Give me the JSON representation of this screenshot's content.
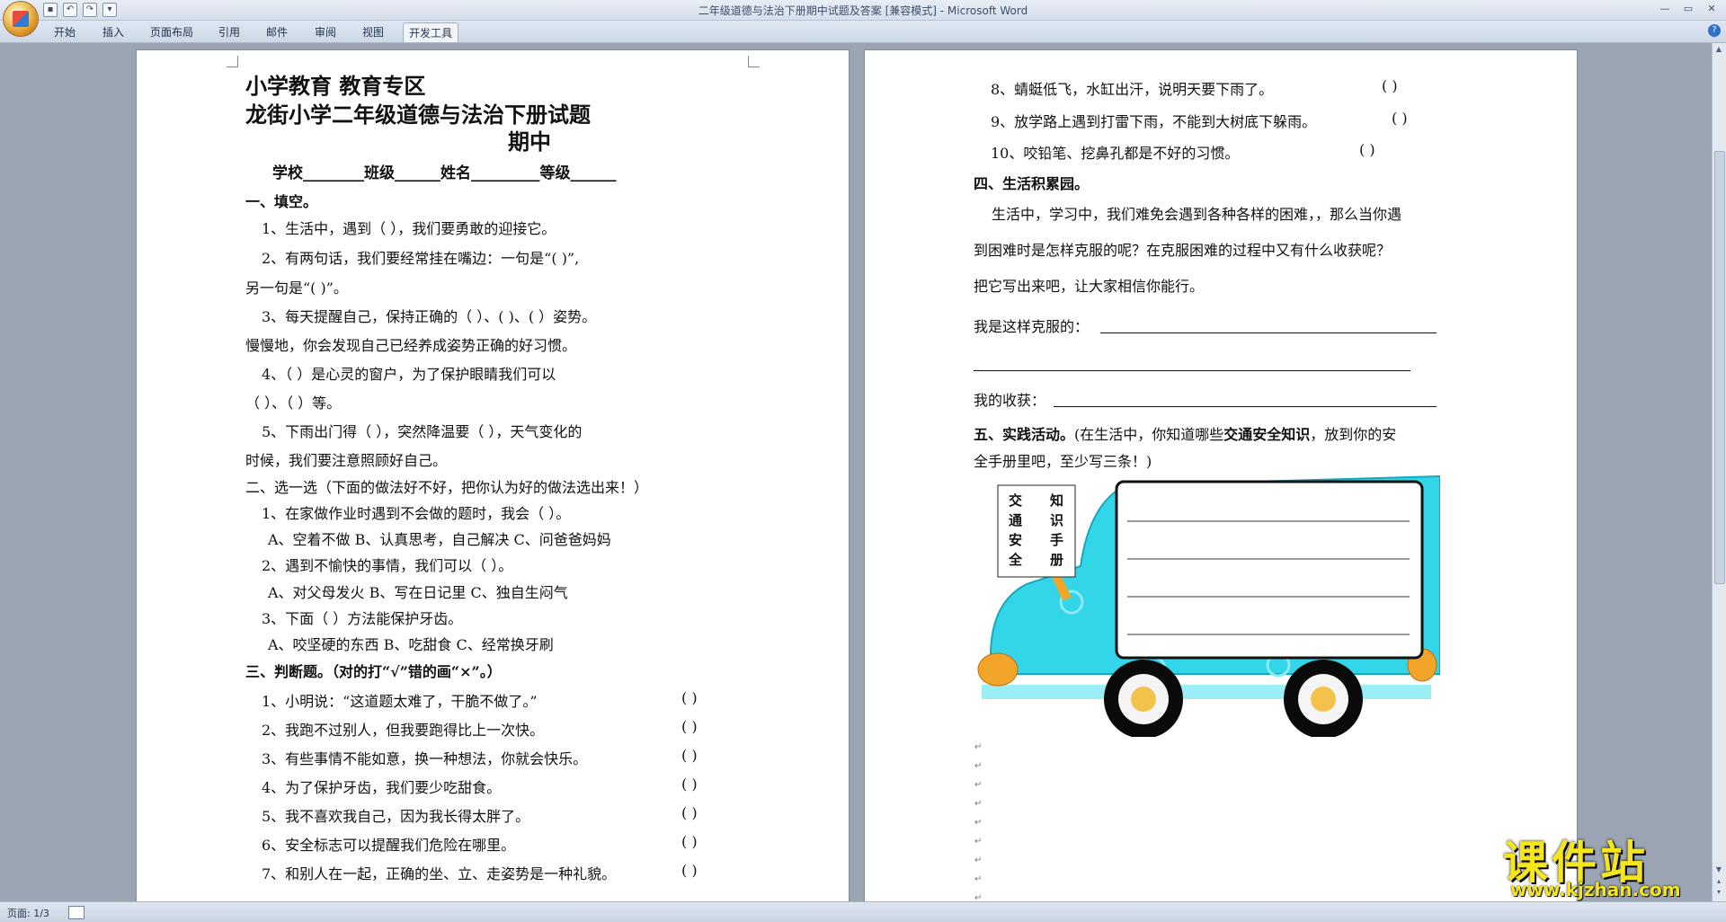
{
  "window": {
    "title": "二年级道德与法治下册期中试题及答案 [兼容模式] - Microsoft Word",
    "qat_icons": [
      "save-icon",
      "undo-icon",
      "redo-icon",
      "customize-icon"
    ]
  },
  "tabs": [
    {
      "id": "home",
      "label": "开始"
    },
    {
      "id": "insert",
      "label": "插入"
    },
    {
      "id": "layout",
      "label": "页面布局"
    },
    {
      "id": "references",
      "label": "引用"
    },
    {
      "id": "mailings",
      "label": "邮件"
    },
    {
      "id": "review",
      "label": "审阅"
    },
    {
      "id": "view",
      "label": "视图"
    },
    {
      "id": "developer",
      "label": "开发工具",
      "active": true
    }
  ],
  "page1": {
    "header1": "小学教育  教育专区",
    "title": "龙街小学二年级道德与法治下册试题",
    "title2": "期中",
    "info": "学校________班级______姓名_________等级______",
    "sec1": "一、填空。",
    "q1_1": "1、生活中，遇到（            ），我们要勇敢的迎接它。",
    "q1_2a": "2、有两句话，我们要经常挂在嘴边：一句是“(                  )”,",
    "q1_2b": "另一句是“(                  )”。",
    "q1_3a": "3、每天提醒自己，保持正确的（        ）、(        )、(        ）姿势。",
    "q1_3b": "慢慢地，你会发现自己已经养成姿势正确的好习惯。",
    "q1_4a": "4、（              ）是心灵的窗户，为了保护眼睛我们可以",
    "q1_4b": "（                    ）、（                    ）等。",
    "q1_5a": "5、下雨出门得（          ），突然降温要（          ），天气变化的",
    "q1_5b": "时候，我们要注意照顾好自己。",
    "sec2": "二、选一选（下面的做法好不好，把你认为好的做法选出来！）",
    "q2_1": "1、在家做作业时遇到不会做的题时，我会（      ）。",
    "q2_1o": "A、空着不做  B、认真思考，自己解决  C、问爸爸妈妈",
    "q2_2": "2、遇到不愉快的事情，我们可以（        ）。",
    "q2_2o": "A、对父母发火        B、写在日记里        C、独自生闷气",
    "q2_3": "3、下面（        ）方法能保护牙齿。",
    "q2_3o": "A、咬坚硬的东西      B、吃甜食    C、经常换牙刷",
    "sec3": "三、判断题。（对的打“√”错的画“×”。）",
    "q3": [
      {
        "text": "1、小明说：“这道题太难了，干脆不做了。”",
        "bracket": "(        )"
      },
      {
        "text": "2、我跑不过别人，但我要跑得比上一次快。",
        "bracket": "(        )"
      },
      {
        "text": "3、有些事情不能如意，换一种想法，你就会快乐。",
        "bracket": "(        )"
      },
      {
        "text": "4、为了保护牙齿，我们要少吃甜食。",
        "bracket": "(        )"
      },
      {
        "text": "5、我不喜欢我自己，因为我长得太胖了。",
        "bracket": "(        )"
      },
      {
        "text": "6、安全标志可以提醒我们危险在哪里。",
        "bracket": "(        )"
      },
      {
        "text": "7、和别人在一起，正确的坐、立、走姿势是一种礼貌。",
        "bracket": "(        )"
      }
    ]
  },
  "page2": {
    "q3_8": "8、蜻蜓低飞，水缸出汗，说明天要下雨了。",
    "q3_9": "9、放学路上遇到打雷下雨，不能到大树底下躲雨。",
    "q3_10": "10、咬铅笔、挖鼻孔都是不好的习惯。",
    "bracket": "(        )",
    "sec4": "四、生活积累园。",
    "p4a": "生活中，学习中，我们难免会遇到各种各样的困难，，那么当你遇",
    "p4b": "到困难时是怎样克服的呢？在克服困难的过程中又有什么收获呢？",
    "p4c": "把它写出来吧，让大家相信你能行。",
    "overcome": "我是这样克服的：",
    "gain": "我的收获：",
    "sec5_bold": "五、实践活动。",
    "sec5_rest": "(在生活中，你知道哪些",
    "sec5_bold2": "交通安全知识",
    "sec5_rest2": "，放到你的安",
    "sec5_line2": "全手册里吧，至少写三条！)",
    "sign": [
      "交",
      "知",
      "通",
      "识",
      "安",
      "手",
      "全",
      "册"
    ]
  },
  "status": {
    "page": "页面: 1/3"
  },
  "watermark": {
    "big": "课件站",
    "url": "www.kjzhan.com"
  },
  "colors": {
    "car_body": "#33d6e8",
    "car_dark": "#0a0a0a",
    "watermark": "#f4e61a"
  }
}
